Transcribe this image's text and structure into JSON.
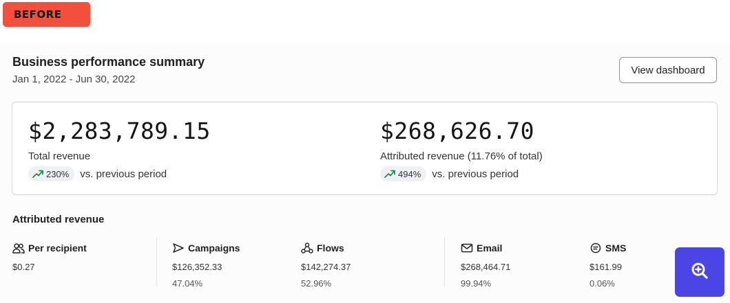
{
  "badge": {
    "label": "BEFORE"
  },
  "header": {
    "title": "Business performance summary",
    "date_range": "Jan 1, 2022 - Jun 30, 2022",
    "view_button": "View dashboard"
  },
  "summary": {
    "total": {
      "value": "$2,283,789.15",
      "label": "Total revenue",
      "change": "230%",
      "comparison": "vs. previous period"
    },
    "attributed": {
      "value": "$268,626.70",
      "label": "Attributed revenue (11.76% of total)",
      "change": "494%",
      "comparison": "vs. previous period"
    }
  },
  "attributed_section": {
    "title": "Attributed revenue",
    "stats": [
      {
        "label": "Per recipient",
        "icon": "users-icon",
        "amount": "$0.27",
        "percent": ""
      },
      {
        "label": "Campaigns",
        "icon": "send-icon",
        "amount": "$126,352.33",
        "percent": "47.04%"
      },
      {
        "label": "Flows",
        "icon": "flows-icon",
        "amount": "$142,274.37",
        "percent": "52.96%"
      },
      {
        "label": "Email",
        "icon": "mail-icon",
        "amount": "$268,464.71",
        "percent": "99.94%"
      },
      {
        "label": "SMS",
        "icon": "sms-icon",
        "amount": "$161.99",
        "percent": "0.06%"
      }
    ]
  },
  "colors": {
    "badge": "#f24f3d",
    "trend_up": "#1f8f4e",
    "zoom_button": "#4b45e5"
  },
  "zoom_button": {
    "icon": "zoom-in-icon"
  }
}
